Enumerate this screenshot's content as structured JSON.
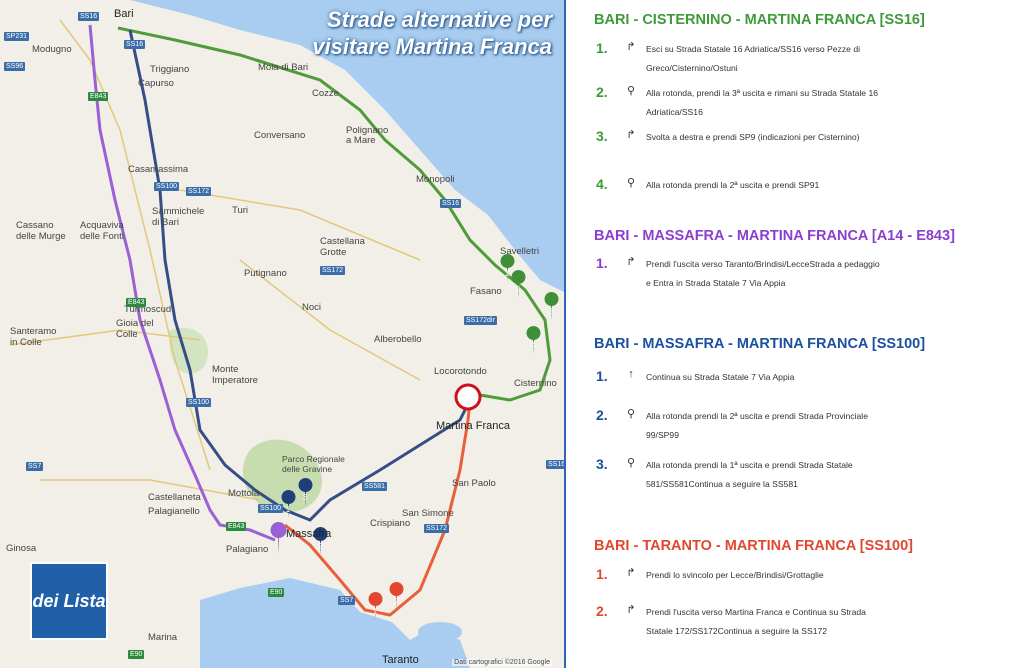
{
  "map": {
    "title_line1": "Strade alternative per",
    "title_line2": "visitare Martina Franca",
    "credit": "Dati cartografici ©2016 Google",
    "logo_text": "dei Lista",
    "towns": [
      {
        "id": "bari",
        "label": "Bari"
      },
      {
        "id": "modugno",
        "label": "Modugno"
      },
      {
        "id": "triggiano",
        "label": "Triggiano"
      },
      {
        "id": "capurso",
        "label": "Capurso"
      },
      {
        "id": "mola",
        "label": "Mola di Bari"
      },
      {
        "id": "cozze",
        "label": "Cozze"
      },
      {
        "id": "polignano",
        "label": "Polignano a Mare"
      },
      {
        "id": "conversano",
        "label": "Conversano"
      },
      {
        "id": "casamassima",
        "label": "Casamassima"
      },
      {
        "id": "monopoli",
        "label": "Monopoli"
      },
      {
        "id": "turi",
        "label": "Turi"
      },
      {
        "id": "sammichele",
        "label": "Sammichele di Bari"
      },
      {
        "id": "acquaviva",
        "label": "Acquaviva delle Fonti"
      },
      {
        "id": "cassano",
        "label": "Cassano delle Murge"
      },
      {
        "id": "castellana",
        "label": "Castellana Grotte"
      },
      {
        "id": "savelletri",
        "label": "Savelletri"
      },
      {
        "id": "putignano",
        "label": "Putignano"
      },
      {
        "id": "fasano",
        "label": "Fasano"
      },
      {
        "id": "noci",
        "label": "Noci"
      },
      {
        "id": "santeramo",
        "label": "Santeramo in Colle"
      },
      {
        "id": "gioia",
        "label": "Gioia del Colle"
      },
      {
        "id": "turmoscud",
        "label": "Turmoscud"
      },
      {
        "id": "alberobello",
        "label": "Alberobello"
      },
      {
        "id": "locorotondo",
        "label": "Locorotondo"
      },
      {
        "id": "monteimp",
        "label": "Monte Imperatore"
      },
      {
        "id": "cisternino",
        "label": "Cisternino"
      },
      {
        "id": "martina",
        "label": "Martina Franca"
      },
      {
        "id": "parco",
        "label": "Parco Regionale delle Gravine"
      },
      {
        "id": "mottola",
        "label": "Mottola"
      },
      {
        "id": "sanpaolo",
        "label": "San Paolo"
      },
      {
        "id": "castellaneta",
        "label": "Castellaneta"
      },
      {
        "id": "palagianello",
        "label": "Palagianello"
      },
      {
        "id": "crispiano",
        "label": "Crispiano"
      },
      {
        "id": "sansimone",
        "label": "San Simone"
      },
      {
        "id": "massafra",
        "label": "Massafra"
      },
      {
        "id": "palagiano",
        "label": "Palagiano"
      },
      {
        "id": "ginosa",
        "label": "Ginosa"
      },
      {
        "id": "marina",
        "label": "Marina"
      },
      {
        "id": "taranto",
        "label": "Taranto"
      }
    ],
    "shields": [
      "SS16",
      "SP231",
      "SS96",
      "E843",
      "SS100",
      "SS172",
      "SS16",
      "SS16",
      "E843",
      "SS100",
      "SS172",
      "SS172dir",
      "SS100",
      "SS581",
      "SS7",
      "E843",
      "SS172",
      "SS7",
      "E90",
      "E90",
      "SS16"
    ],
    "colors": {
      "green": "#4f9b3a",
      "purple": "#9b5fd6",
      "navy": "#364d88",
      "red": "#e8603a",
      "sea": "#97c3eb"
    }
  },
  "routes": [
    {
      "title": "BARI - CISTERNINO - MARTINA FRANCA [SS16]",
      "color": "green",
      "steps": [
        {
          "num": "1.",
          "icon": "turn-right",
          "text": "Esci su Strada Statale 16 Adriatica/SS16 verso Pezze di Greco/Cisternino/Ostuni"
        },
        {
          "num": "2.",
          "icon": "roundabout",
          "text": "Alla rotonda, prendi la 3ª uscita e rimani su Strada Statale 16 Adriatica/SS16"
        },
        {
          "num": "3.",
          "icon": "turn-right",
          "text": "Svolta a destra e prendi SP9 (indicazioni per Cisternino)"
        },
        {
          "num": "4.",
          "icon": "roundabout",
          "text": "Alla rotonda prendi la 2ª uscita e prendi SP91"
        }
      ]
    },
    {
      "title": "BARI - MASSAFRA - MARTINA FRANCA [A14 - E843]",
      "color": "purple",
      "steps": [
        {
          "num": "1.",
          "icon": "keep-right",
          "text": "Prendi l'uscita verso Taranto/Brindisi/LecceStrada a pedaggio  e  Entra in Strada Statale 7 Via Appia"
        }
      ]
    },
    {
      "title": "BARI - MASSAFRA - MARTINA FRANCA [SS100]",
      "color": "navy",
      "steps": [
        {
          "num": "1.",
          "icon": "straight",
          "text": "Continua su Strada Statale 7 Via Appia"
        },
        {
          "num": "2.",
          "icon": "roundabout",
          "text": "Alla rotonda prendi la 2ª uscita e prendi Strada Provinciale 99/SP99"
        },
        {
          "num": "3.",
          "icon": "roundabout",
          "text": "Alla rotonda prendi la 1ª uscita e prendi Strada Statale 581/SS581Continua a seguire la SS581"
        }
      ]
    },
    {
      "title": "BARI - TARANTO - MARTINA FRANCA [SS100]",
      "color": "red",
      "steps": [
        {
          "num": "1.",
          "icon": "keep-right",
          "text": "Prendi lo svincolo per Lecce/Brindisi/Grottaglie"
        },
        {
          "num": "2.",
          "icon": "keep-right",
          "text": "Prendi l'uscita verso Martina Franca     e    Continua su Strada Statale 172/SS172Continua a seguire la SS172"
        }
      ]
    }
  ],
  "markers": [
    "1",
    "2",
    "3",
    "4",
    "1",
    "3",
    "2",
    "1",
    "2"
  ]
}
